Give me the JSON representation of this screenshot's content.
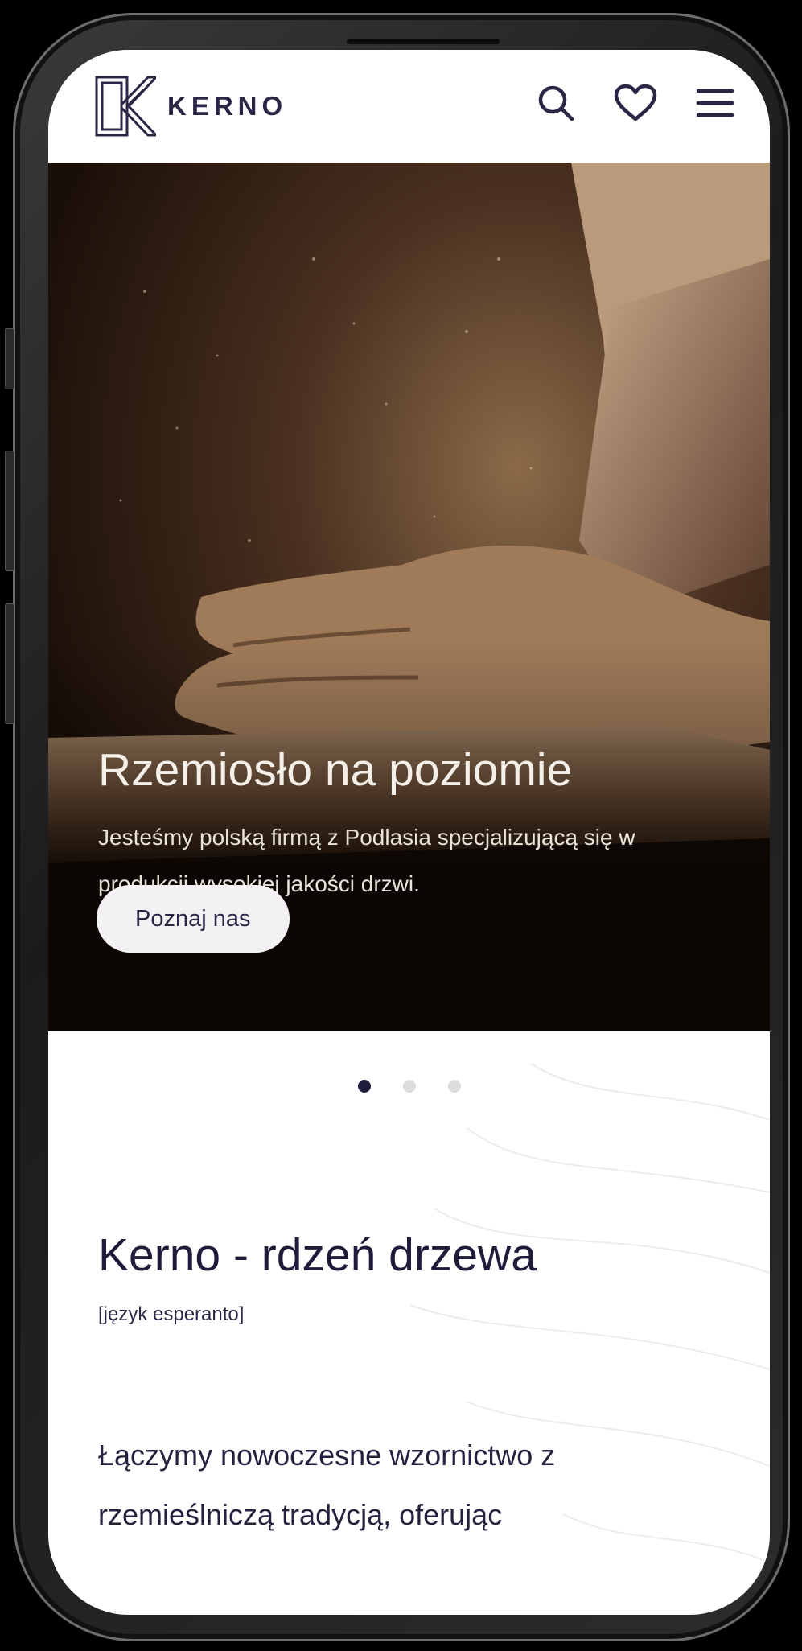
{
  "brand": {
    "logo_text": "KERNO",
    "accent": "#2a2746"
  },
  "header": {
    "icons": [
      "search-icon",
      "heart-icon",
      "hamburger-menu-icon"
    ]
  },
  "hero": {
    "title": "Rzemiosło na poziomie",
    "text": "Jesteśmy polską firmą z Podlasia specjalizującą się w produkcji wysokiej jakości drzwi.",
    "button_label": "Poznaj nas"
  },
  "carousel": {
    "slides": 3,
    "active_index": 0
  },
  "about": {
    "title": "Kerno - rdzeń drzewa",
    "subtitle": "[język esperanto]",
    "text": "Łączymy nowoczesne wzornictwo z rzemieślniczą tradycją, oferując"
  }
}
